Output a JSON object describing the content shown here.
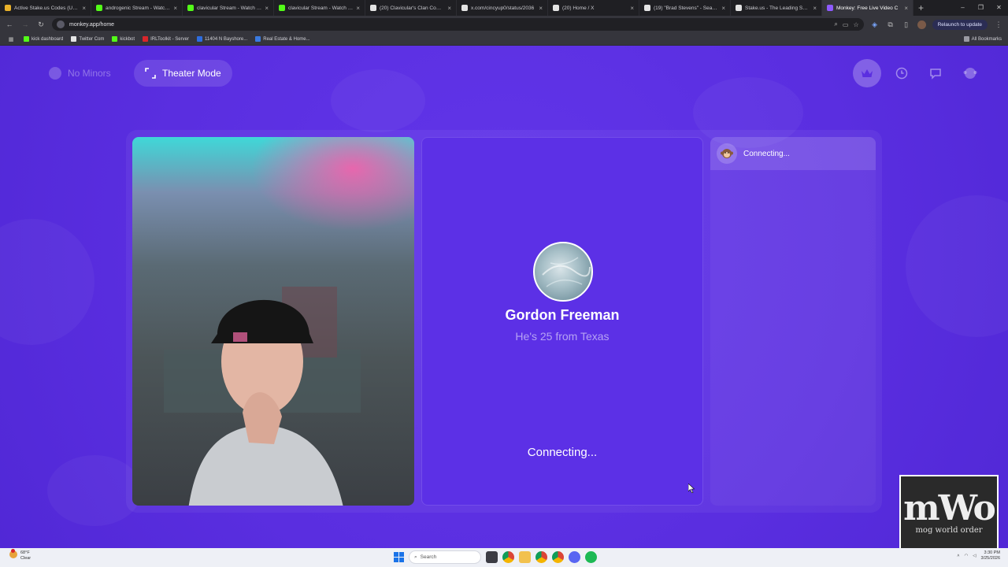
{
  "browser": {
    "tabs": [
      {
        "label": "Active Stake.us Codes (Updat",
        "color": "#e8b12a"
      },
      {
        "label": "androgenic Stream - Watch Li",
        "color": "#53fc18"
      },
      {
        "label": "clavicular Stream - Watch Live",
        "color": "#53fc18"
      },
      {
        "label": "clavicular Stream - Watch Live",
        "color": "#53fc18"
      },
      {
        "label": "(20) Clavicular's Clan Commu",
        "color": "#1d1d1d"
      },
      {
        "label": "x.com/cincyup0/status/2036",
        "color": "#1d1d1d"
      },
      {
        "label": "(20) Home / X",
        "color": "#1d1d1d"
      },
      {
        "label": "(19) \"Brad Stevens\" - Search /",
        "color": "#1d1d1d"
      },
      {
        "label": "Stake.us - The Leading Social",
        "color": "#1d1d1d"
      },
      {
        "label": "Monkey: Free Live Video C",
        "color": "#8e5aff"
      }
    ],
    "tab_close": "×",
    "new_tab": "+",
    "window_controls": [
      "–",
      "❐",
      "✕"
    ],
    "url": "monkey.app/home",
    "relaunch_label": "Relaunch to update",
    "bookmarks": [
      {
        "label": "kick dashboard",
        "color": "#53fc18"
      },
      {
        "label": "Twitter Com",
        "color": "#1d1d1d"
      },
      {
        "label": "kickbot",
        "color": "#53fc18"
      },
      {
        "label": "IRLToolkit - Server",
        "color": "#d8262b"
      },
      {
        "label": "11404 N Bayshore...",
        "color": "#2d6cdf"
      },
      {
        "label": "Real Estate & Home...",
        "color": "#3a7ae0"
      }
    ],
    "all_bookmarks": "All Bookmarks"
  },
  "page": {
    "no_minors_label": "No Minors",
    "theater_label": "Theater Mode",
    "match": {
      "name": "Gordon Freeman",
      "subtitle": "He's 25 from Texas",
      "status": "Connecting..."
    },
    "side": {
      "status": "Connecting...",
      "icon": "monkey-icon"
    }
  },
  "watermark": {
    "big": "mWo",
    "small": "mog world order"
  },
  "taskbar": {
    "weather_temp": "68°F",
    "weather_cond": "Clear",
    "search_label": "Search",
    "time": "3:30 PM",
    "date": "3/25/2026"
  },
  "colors": {
    "accent": "#5b2fe0",
    "panel": "#5c30e6"
  }
}
